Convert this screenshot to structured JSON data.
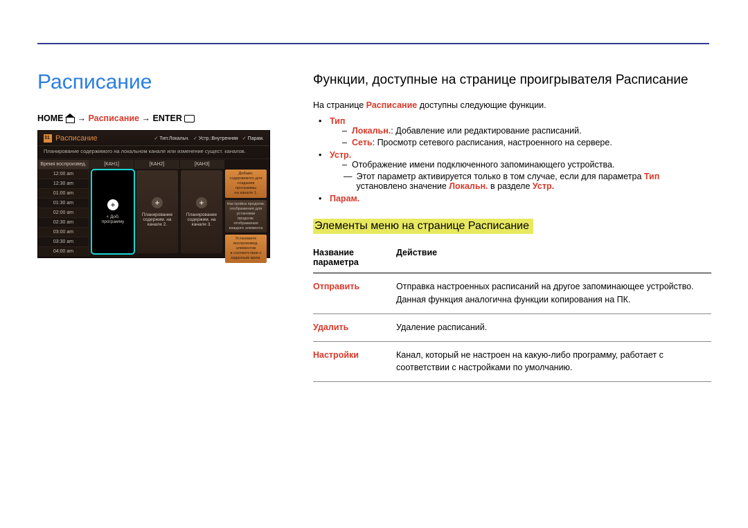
{
  "page_title": "Расписание",
  "breadcrumb": {
    "home": "HOME",
    "arrow": "→",
    "mid": "Расписание",
    "enter": "ENTER"
  },
  "mock": {
    "title": "Расписание",
    "top_right": [
      "Тип:Локальн.",
      "Устр.:Внутренняя",
      "Парам."
    ],
    "subtitle": "Планирование содержимого на локальном канале или изменение сущест. каналов.",
    "time_head": "Время воспроизвед.",
    "times": [
      "12:00 am",
      "12:30 am",
      "01:00 am",
      "01:30 am",
      "02:00 am",
      "02:30 am",
      "03:00 am",
      "03:30 am",
      "04:00 am"
    ],
    "col_heads": [
      "[КАН1]",
      "[КАН2]",
      "[КАН3]"
    ],
    "tile1": "+ Доб. программу",
    "tile2a": "Планирование",
    "tile2b": "содержим. на",
    "tile2c": "канале 2.",
    "tile3a": "Планирование",
    "tile3b": "содержим. на",
    "tile3c": "канале 3.",
    "r1a": "Добавл.",
    "r1b": "содержимого для",
    "r1c": "создания программы",
    "r1d": "на канале 1.",
    "r2a": "Настройка продолж.",
    "r2b": "отображения для установки",
    "r2c": "продолж. отображения",
    "r2d": "каждого элемента",
    "r3a": "Установите",
    "r3b": "воспроизвед. элементов",
    "r3c": "в соответствии с",
    "r3d": "заданным врем."
  },
  "right": {
    "heading": "Функции, доступные на странице проигрывателя Расписание",
    "intro_a": "На странице ",
    "intro_b": "Расписание",
    "intro_c": " доступны следующие функции.",
    "type_label": "Тип",
    "type_local_label": "Локальн.",
    "type_local_text": ": Добавление или редактирование расписаний.",
    "type_net_label": "Сеть",
    "type_net_text": ": Просмотр сетевого расписания, настроенного на сервере.",
    "ustr_label": "Устр.",
    "ustr_text": "Отображение имени подключенного запоминающего устройства.",
    "ustr_note_a": "Этот параметр активируется только в том случае, если для параметра ",
    "ustr_note_b": "Тип",
    "ustr_note_c": " установлено значение ",
    "ustr_note_d": "Локальн.",
    "ustr_note_e": " в разделе ",
    "ustr_note_f": "Устр.",
    "param_label": "Парам.",
    "subheading": "Элементы меню на странице Расписание",
    "th1a": "Название",
    "th1b": "параметра",
    "th2": "Действие",
    "rows": [
      {
        "name": "Отправить",
        "desc": "Отправка настроенных расписаний на другое запоминающее устройство. Данная функция аналогична функции копирования на ПК."
      },
      {
        "name": "Удалить",
        "desc": "Удаление расписаний."
      },
      {
        "name": "Настройки",
        "desc": "Канал, который не настроен на какую-либо программу, работает с соответствии с настройками по умолчанию."
      }
    ]
  }
}
